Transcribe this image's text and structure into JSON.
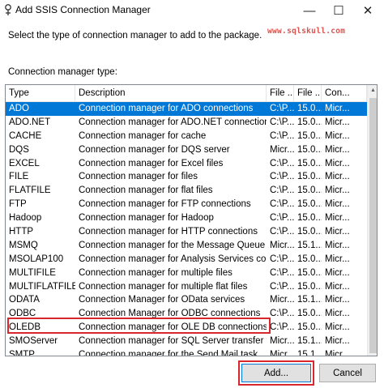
{
  "window": {
    "title": "Add SSIS Connection Manager",
    "minimize": "—",
    "maximize": "☐",
    "close": "✕"
  },
  "instruction": "Select the type of connection manager to add to the package.",
  "watermark": "www.sqlskull.com",
  "list_label": "Connection manager type:",
  "columns": [
    "Type",
    "Description",
    "File ...",
    "File ...",
    "Con..."
  ],
  "rows": [
    {
      "type": "ADO",
      "desc": "Connection manager for ADO connections",
      "f1": "C:\\P...",
      "f2": "15.0...",
      "con": "Micr..."
    },
    {
      "type": "ADO.NET",
      "desc": "Connection manager for ADO.NET connections",
      "f1": "C:\\P...",
      "f2": "15.0...",
      "con": "Micr..."
    },
    {
      "type": "CACHE",
      "desc": "Connection manager for cache",
      "f1": "C:\\P...",
      "f2": "15.0...",
      "con": "Micr..."
    },
    {
      "type": "DQS",
      "desc": "Connection manager for DQS server",
      "f1": "Micr...",
      "f2": "15.0...",
      "con": "Micr..."
    },
    {
      "type": "EXCEL",
      "desc": "Connection manager for Excel files",
      "f1": "C:\\P...",
      "f2": "15.0...",
      "con": "Micr..."
    },
    {
      "type": "FILE",
      "desc": "Connection manager for files",
      "f1": "C:\\P...",
      "f2": "15.0...",
      "con": "Micr..."
    },
    {
      "type": "FLATFILE",
      "desc": "Connection manager for flat files",
      "f1": "C:\\P...",
      "f2": "15.0...",
      "con": "Micr..."
    },
    {
      "type": "FTP",
      "desc": "Connection manager for FTP connections",
      "f1": "C:\\P...",
      "f2": "15.0...",
      "con": "Micr..."
    },
    {
      "type": "Hadoop",
      "desc": "Connection manager for Hadoop",
      "f1": "C:\\P...",
      "f2": "15.0...",
      "con": "Micr..."
    },
    {
      "type": "HTTP",
      "desc": "Connection manager for HTTP connections",
      "f1": "C:\\P...",
      "f2": "15.0...",
      "con": "Micr..."
    },
    {
      "type": "MSMQ",
      "desc": "Connection manager for the Message Queue task",
      "f1": "Micr...",
      "f2": "15.1...",
      "con": "Micr..."
    },
    {
      "type": "MSOLAP100",
      "desc": "Connection manager for Analysis Services conn...",
      "f1": "C:\\P...",
      "f2": "15.0...",
      "con": "Micr..."
    },
    {
      "type": "MULTIFILE",
      "desc": "Connection manager for multiple files",
      "f1": "C:\\P...",
      "f2": "15.0...",
      "con": "Micr..."
    },
    {
      "type": "MULTIFLATFILE",
      "desc": "Connection manager for multiple flat files",
      "f1": "C:\\P...",
      "f2": "15.0...",
      "con": "Micr..."
    },
    {
      "type": "ODATA",
      "desc": "Connection Manager for OData services",
      "f1": "Micr...",
      "f2": "15.1...",
      "con": "Micr..."
    },
    {
      "type": "ODBC",
      "desc": "Connection Manager for ODBC connections",
      "f1": "C:\\P...",
      "f2": "15.0...",
      "con": "Micr..."
    },
    {
      "type": "OLEDB",
      "desc": "Connection manager for OLE DB connections",
      "f1": "C:\\P...",
      "f2": "15.0...",
      "con": "Micr..."
    },
    {
      "type": "SMOServer",
      "desc": "Connection manager for SQL Server transfer ta...",
      "f1": "Micr...",
      "f2": "15.1...",
      "con": "Micr..."
    },
    {
      "type": "SMTP",
      "desc": "Connection manager for the Send Mail task",
      "f1": "Micr...",
      "f2": "15.1...",
      "con": "Micr..."
    }
  ],
  "selected_type": "ADO",
  "highlighted_type": "OLEDB",
  "buttons": {
    "add": "Add...",
    "cancel": "Cancel"
  },
  "scrollbar": {
    "up_arrow": "▲"
  },
  "colors": {
    "selection": "#0078d7",
    "highlight": "#d9272e"
  }
}
